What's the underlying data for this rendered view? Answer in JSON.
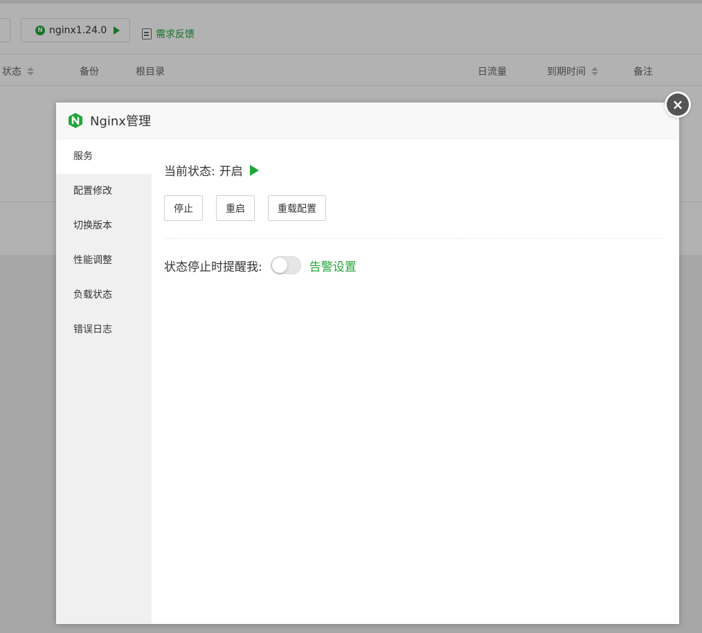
{
  "background": {
    "toolbar": {
      "nginx_button_label": "nginx1.24.0",
      "feedback_label": "需求反馈"
    },
    "table_headers": [
      "状态",
      "备份",
      "根目录",
      "日流量",
      "到期时间",
      "备注"
    ]
  },
  "dialog": {
    "title": "Nginx管理",
    "close_label": "×",
    "nav": [
      {
        "label": "服务",
        "active": true
      },
      {
        "label": "配置修改",
        "active": false
      },
      {
        "label": "切换版本",
        "active": false
      },
      {
        "label": "性能调整",
        "active": false
      },
      {
        "label": "负载状态",
        "active": false
      },
      {
        "label": "错误日志",
        "active": false
      }
    ],
    "service": {
      "status_label": "当前状态:",
      "status_value": "开启",
      "buttons": [
        "停止",
        "重启",
        "重载配置"
      ],
      "alert_label": "状态停止时提醒我:",
      "alert_toggle_on": false,
      "alert_settings_label": "告警设置"
    }
  },
  "colors": {
    "brand_green": "#20a53a",
    "overlay": "rgba(0,0,0,0.3)"
  }
}
